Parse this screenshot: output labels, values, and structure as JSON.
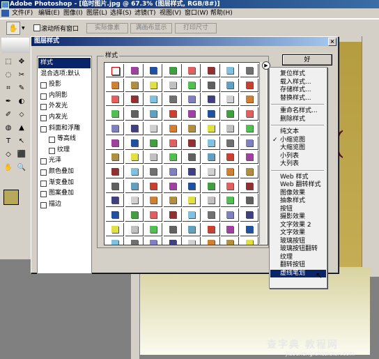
{
  "title_bar": {
    "text": "Adobe Photoshop - [临时图片.jpg @ 67.3% (图层样式, RGB/8#)]"
  },
  "menubar": {
    "items": [
      "文件(F)",
      "编辑(E)",
      "图像(I)",
      "图层(L)",
      "选择(S)",
      "滤镜(T)",
      "视图(V)",
      "窗口(W)",
      "帮助(H)"
    ]
  },
  "options_bar": {
    "scroll_all": "滚动所有窗口",
    "actual_pixels": "实际像素",
    "fit_screen": "满画布显示",
    "print_size": "打印尺寸"
  },
  "dialog": {
    "title": "图层样式",
    "ok_label": "好",
    "close_label": "×",
    "styles_label": "样式",
    "left_items": [
      {
        "label": "样式",
        "checkbox": false,
        "selected": true
      },
      {
        "label": "混合选项:默认",
        "checkbox": false,
        "selected": false
      },
      {
        "label": "投影",
        "checkbox": true,
        "selected": false
      },
      {
        "label": "内阴影",
        "checkbox": true,
        "selected": false
      },
      {
        "label": "外发光",
        "checkbox": true,
        "selected": false
      },
      {
        "label": "内发光",
        "checkbox": true,
        "selected": false
      },
      {
        "label": "斜面和浮雕",
        "checkbox": true,
        "selected": false
      },
      {
        "label": "等高线",
        "checkbox": true,
        "selected": false,
        "indent": true
      },
      {
        "label": "纹理",
        "checkbox": true,
        "selected": false,
        "indent": true
      },
      {
        "label": "光泽",
        "checkbox": true,
        "selected": false
      },
      {
        "label": "颜色叠加",
        "checkbox": true,
        "selected": false
      },
      {
        "label": "渐变叠加",
        "checkbox": true,
        "selected": false
      },
      {
        "label": "图案叠加",
        "checkbox": true,
        "selected": false
      },
      {
        "label": "描边",
        "checkbox": true,
        "selected": false
      }
    ]
  },
  "popup_menu": {
    "groups": [
      [
        "复位样式",
        "载入样式...",
        "存储样式...",
        "替换样式..."
      ],
      [
        "重命名样式...",
        "删除样式"
      ],
      [
        "纯文本",
        "小缩览图",
        "大缩览图",
        "小列表",
        "大列表"
      ],
      [
        "Web 样式",
        "Web 翻转样式",
        "图像效果",
        "抽象样式",
        "按钮",
        "摄影效果",
        "文字效果 2",
        "文字效果",
        "玻璃按钮",
        "玻璃按钮翻转",
        "纹理",
        "翻转按钮",
        "虚线笔划"
      ]
    ],
    "checked_item": "小缩览图",
    "highlighted_item": "虚线笔划"
  },
  "canvas": {
    "partial_glyph": "("
  },
  "watermark": {
    "text": "查字典 教程网",
    "url": "jiaocheng.chazidian.com"
  },
  "colors": {
    "title_dark": "#0a246a",
    "highlight": "#0a246a",
    "ui_face": "#d4d0c8",
    "foreground_swatch": "#b8a85a"
  }
}
